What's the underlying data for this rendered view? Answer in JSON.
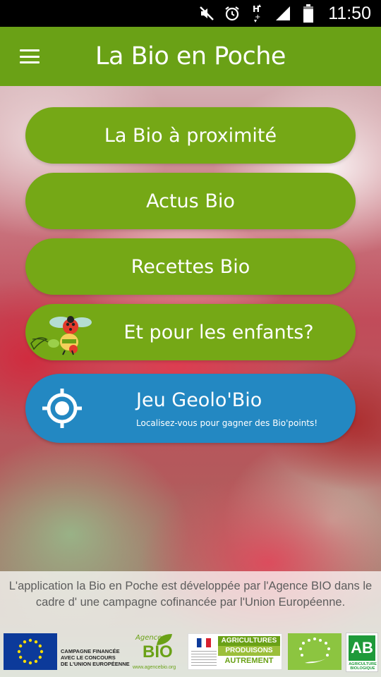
{
  "status_bar": {
    "time": "11:50",
    "icons": [
      "mute-icon",
      "alarm-icon",
      "hplus-signal-icon",
      "signal-icon",
      "battery-icon"
    ]
  },
  "app_bar": {
    "title": "La Bio en Poche",
    "menu_icon": "hamburger-menu-icon",
    "color": "#6aa116"
  },
  "menu": {
    "items": [
      {
        "label": "La Bio à proximité"
      },
      {
        "label": "Actus Bio"
      },
      {
        "label": "Recettes Bio"
      },
      {
        "label": "Et pour les enfants?",
        "icon": "ladybug-mascot-icon"
      }
    ],
    "button_color": "#75a816"
  },
  "geo": {
    "title": "Jeu Geolo'Bio",
    "subtitle": "Localisez-vous pour gagner des Bio'points!",
    "icon": "location-target-icon",
    "color": "#2388c2"
  },
  "footer": {
    "info_text": "L'application la Bio en Poche est développée par l'Agence BIO dans le cadre d' une campagne cofinancée par l'Union Européenne.",
    "eu_campaign_lines": [
      "CAMPAGNE FINANCÉE",
      "AVEC LE CONCOURS",
      "DE L'UNION EUROPÉENNE"
    ],
    "agence_bio": {
      "prefix": "Agence",
      "name": "BIO",
      "url": "www.agencebio.org"
    },
    "agricultures": [
      "AGRICULTURES",
      "PRODUISONS",
      "AUTREMENT"
    ],
    "ab_logo": {
      "letters": "AB",
      "caption": "AGRICULTURE BIOLOGIQUE"
    }
  }
}
